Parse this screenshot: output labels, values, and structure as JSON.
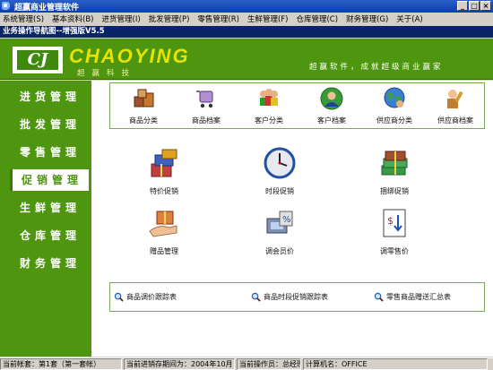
{
  "window": {
    "title": "超赢商业管理软件",
    "buttons": [
      "_",
      "□",
      "×"
    ]
  },
  "menu": [
    "系统管理(S)",
    "基本资料(B)",
    "进货管理(I)",
    "批发管理(P)",
    "零售管理(R)",
    "生鲜管理(F)",
    "仓库管理(C)",
    "财务管理(G)",
    "关于(A)"
  ],
  "document_title": "业务操作导航图--增强版V5.5",
  "banner": {
    "logo": "CJ",
    "brand": "CHAOYING",
    "brand_sub": "超赢科技",
    "slogan": "超赢软件，成就超级商业赢家"
  },
  "sidebar": [
    {
      "label": "进货管理",
      "active": false
    },
    {
      "label": "批发管理",
      "active": false
    },
    {
      "label": "零售管理",
      "active": false
    },
    {
      "label": "促销管理",
      "active": true
    },
    {
      "label": "生鲜管理",
      "active": false
    },
    {
      "label": "仓库管理",
      "active": false
    },
    {
      "label": "财务管理",
      "active": false
    }
  ],
  "top_shortcuts": [
    {
      "label": "商品分类",
      "icon": "boxes-icon"
    },
    {
      "label": "商品档案",
      "icon": "cart-icon"
    },
    {
      "label": "客户分类",
      "icon": "group-icon"
    },
    {
      "label": "客户档案",
      "icon": "customer-icon"
    },
    {
      "label": "供应商分类",
      "icon": "supplier-globe-icon"
    },
    {
      "label": "供应商档案",
      "icon": "supplier-person-icon"
    }
  ],
  "main_actions": [
    {
      "label": "特价促销",
      "icon": "gift-stack-icon"
    },
    {
      "label": "时段促销",
      "icon": "clock-icon"
    },
    {
      "label": "捆绑促销",
      "icon": "money-bundle-icon"
    },
    {
      "label": "赠品管理",
      "icon": "gift-hand-icon"
    },
    {
      "label": "调会员价",
      "icon": "member-price-icon"
    },
    {
      "label": "调零售价",
      "icon": "retail-price-icon"
    }
  ],
  "reports": [
    {
      "label": "商品调价跟踪表",
      "icon": "magnifier-icon"
    },
    {
      "label": "商品时段促销跟踪表",
      "icon": "magnifier-icon"
    },
    {
      "label": "零售商品赠送汇总表",
      "icon": "magnifier-icon"
    }
  ],
  "status": [
    "当前帐套：第1套（第一套帐）",
    "当前进销存期间为：2004年10月",
    "当前操作员：总经理",
    "计算机名：OFFICE"
  ]
}
